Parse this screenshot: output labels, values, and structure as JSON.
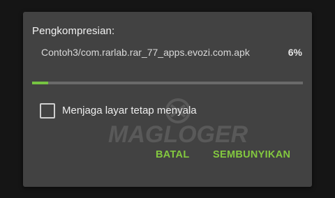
{
  "dialog": {
    "title": "Pengkompresian:",
    "filename": "Contoh3/com.rarlab.rar_77_apps.evozi.com.apk",
    "percent_label": "6%",
    "progress": 0.06,
    "checkbox_label": "Menjaga layar tetap menyala",
    "checkbox_checked": false,
    "cancel_label": "BATAL",
    "hide_label": "SEMBUNYIKAN"
  },
  "colors": {
    "accent": "#83c83f",
    "dialog_bg": "#424242",
    "backdrop": "#151515"
  },
  "watermark": {
    "text": "MAGLOGER"
  }
}
